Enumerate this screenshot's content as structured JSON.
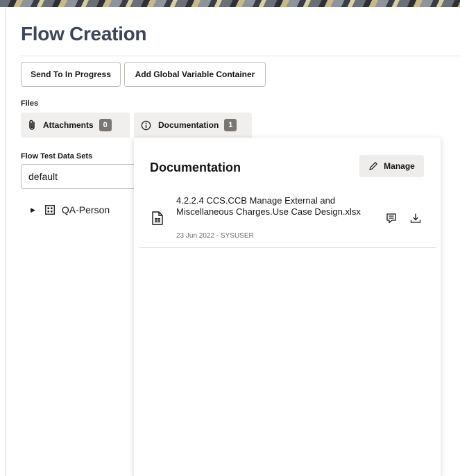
{
  "page": {
    "title": "Flow Creation"
  },
  "toolbar": {
    "send_label": "Send To In Progress",
    "add_label": "Add Global Variable Container"
  },
  "files": {
    "label": "Files",
    "tabs": [
      {
        "label": "Attachments",
        "count": "0",
        "icon": "paperclip-icon"
      },
      {
        "label": "Documentation",
        "count": "1",
        "icon": "info-icon"
      }
    ]
  },
  "data_sets": {
    "label": "Flow Test Data Sets",
    "selected": "default",
    "tree": [
      {
        "label": "QA-Person",
        "icon": "grid-icon"
      }
    ]
  },
  "documentation_panel": {
    "title": "Documentation",
    "manage_label": "Manage",
    "items": [
      {
        "name": "4.2.2.4 CCS.CCB Manage External and Miscellaneous Charges.Use Case Design.xlsx",
        "meta": "23 Jun 2022 - SYSUSER",
        "icon": "spreadsheet-file-icon"
      }
    ]
  },
  "colors": {
    "title": "#3c4559",
    "badge": "#7a7673",
    "tab_bg": "#f0efee"
  }
}
